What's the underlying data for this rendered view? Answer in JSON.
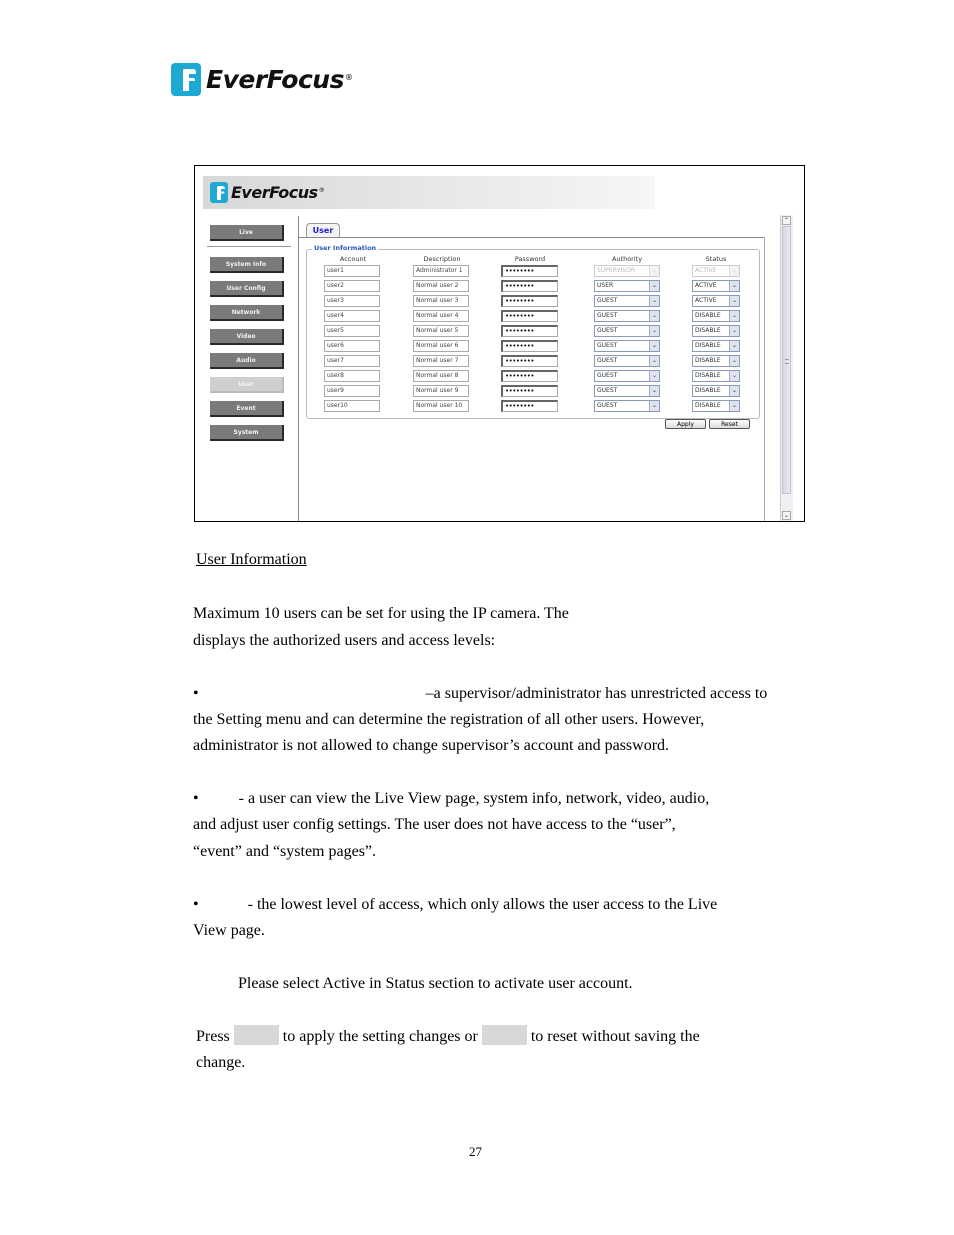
{
  "document": {
    "brand": {
      "name": "EverFocus",
      "registered": "®"
    },
    "page_number": "27"
  },
  "screenshot": {
    "header": {
      "brand": "EverFocus",
      "registered": "®"
    },
    "sidebar": {
      "items": [
        {
          "label": "Live",
          "active": false
        },
        {
          "label": "System Info",
          "active": false
        },
        {
          "label": "User Config",
          "active": false
        },
        {
          "label": "Network",
          "active": false
        },
        {
          "label": "Video",
          "active": false
        },
        {
          "label": "Audio",
          "active": false
        },
        {
          "label": "User",
          "active": true
        },
        {
          "label": "Event",
          "active": false
        },
        {
          "label": "System",
          "active": false
        }
      ]
    },
    "tab": {
      "label": "User"
    },
    "section": {
      "legend": "User Information"
    },
    "columns": [
      "Account",
      "Description",
      "Password",
      "Authority",
      "Status"
    ],
    "rows": [
      {
        "account": "user1",
        "description": "Administrator 1",
        "password": "••••••••",
        "authority": "SUPERVISOR",
        "status": "ACTIVE",
        "disabled": true
      },
      {
        "account": "user2",
        "description": "Normal user 2",
        "password": "••••••••",
        "authority": "USER",
        "status": "ACTIVE",
        "disabled": false
      },
      {
        "account": "user3",
        "description": "Normal user 3",
        "password": "••••••••",
        "authority": "GUEST",
        "status": "ACTIVE",
        "disabled": false
      },
      {
        "account": "user4",
        "description": "Normal user 4",
        "password": "••••••••",
        "authority": "GUEST",
        "status": "DISABLE",
        "disabled": false
      },
      {
        "account": "user5",
        "description": "Normal user 5",
        "password": "••••••••",
        "authority": "GUEST",
        "status": "DISABLE",
        "disabled": false
      },
      {
        "account": "user6",
        "description": "Normal user 6",
        "password": "••••••••",
        "authority": "GUEST",
        "status": "DISABLE",
        "disabled": false
      },
      {
        "account": "user7",
        "description": "Normal user 7",
        "password": "••••••••",
        "authority": "GUEST",
        "status": "DISABLE",
        "disabled": false
      },
      {
        "account": "user8",
        "description": "Normal user 8",
        "password": "••••••••",
        "authority": "GUEST",
        "status": "DISABLE",
        "disabled": false
      },
      {
        "account": "user9",
        "description": "Normal user 9",
        "password": "••••••••",
        "authority": "GUEST",
        "status": "DISABLE",
        "disabled": false
      },
      {
        "account": "user10",
        "description": "Normal user 10",
        "password": "••••••••",
        "authority": "GUEST",
        "status": "DISABLE",
        "disabled": false
      }
    ],
    "buttons": {
      "apply": "Apply",
      "reset": "Reset"
    },
    "scrollbar": {
      "up_glyph": "⌃",
      "down_glyph": "⌄"
    },
    "dropdown_glyph": "⌄"
  },
  "text": {
    "heading": "User Information",
    "intro_line1": "Maximum 10 users can be set for using the IP camera. The",
    "intro_line2": "displays the authorized users and access levels:",
    "bullet": "•",
    "supervisor_line1": "–a supervisor/administrator has unrestricted access to",
    "supervisor_line2": "the Setting menu and can determine the registration of all other users. However,",
    "supervisor_line3": "administrator is not allowed to change supervisor’s account and password.",
    "user_line1": "- a user can view the Live View page, system info, network, video, audio,",
    "user_line2": "and adjust user config settings. The user does not have access to the “user”,",
    "user_line3": "“event” and “system pages”.",
    "guest_line1": "- the lowest level of access, which only allows the user access to the Live",
    "guest_line2": "View page.",
    "note": "Please select Active in Status section to activate user account.",
    "press_a": "Press",
    "press_b": "to apply the setting changes or",
    "press_c": "to reset without saving the",
    "press_line2": "change."
  }
}
